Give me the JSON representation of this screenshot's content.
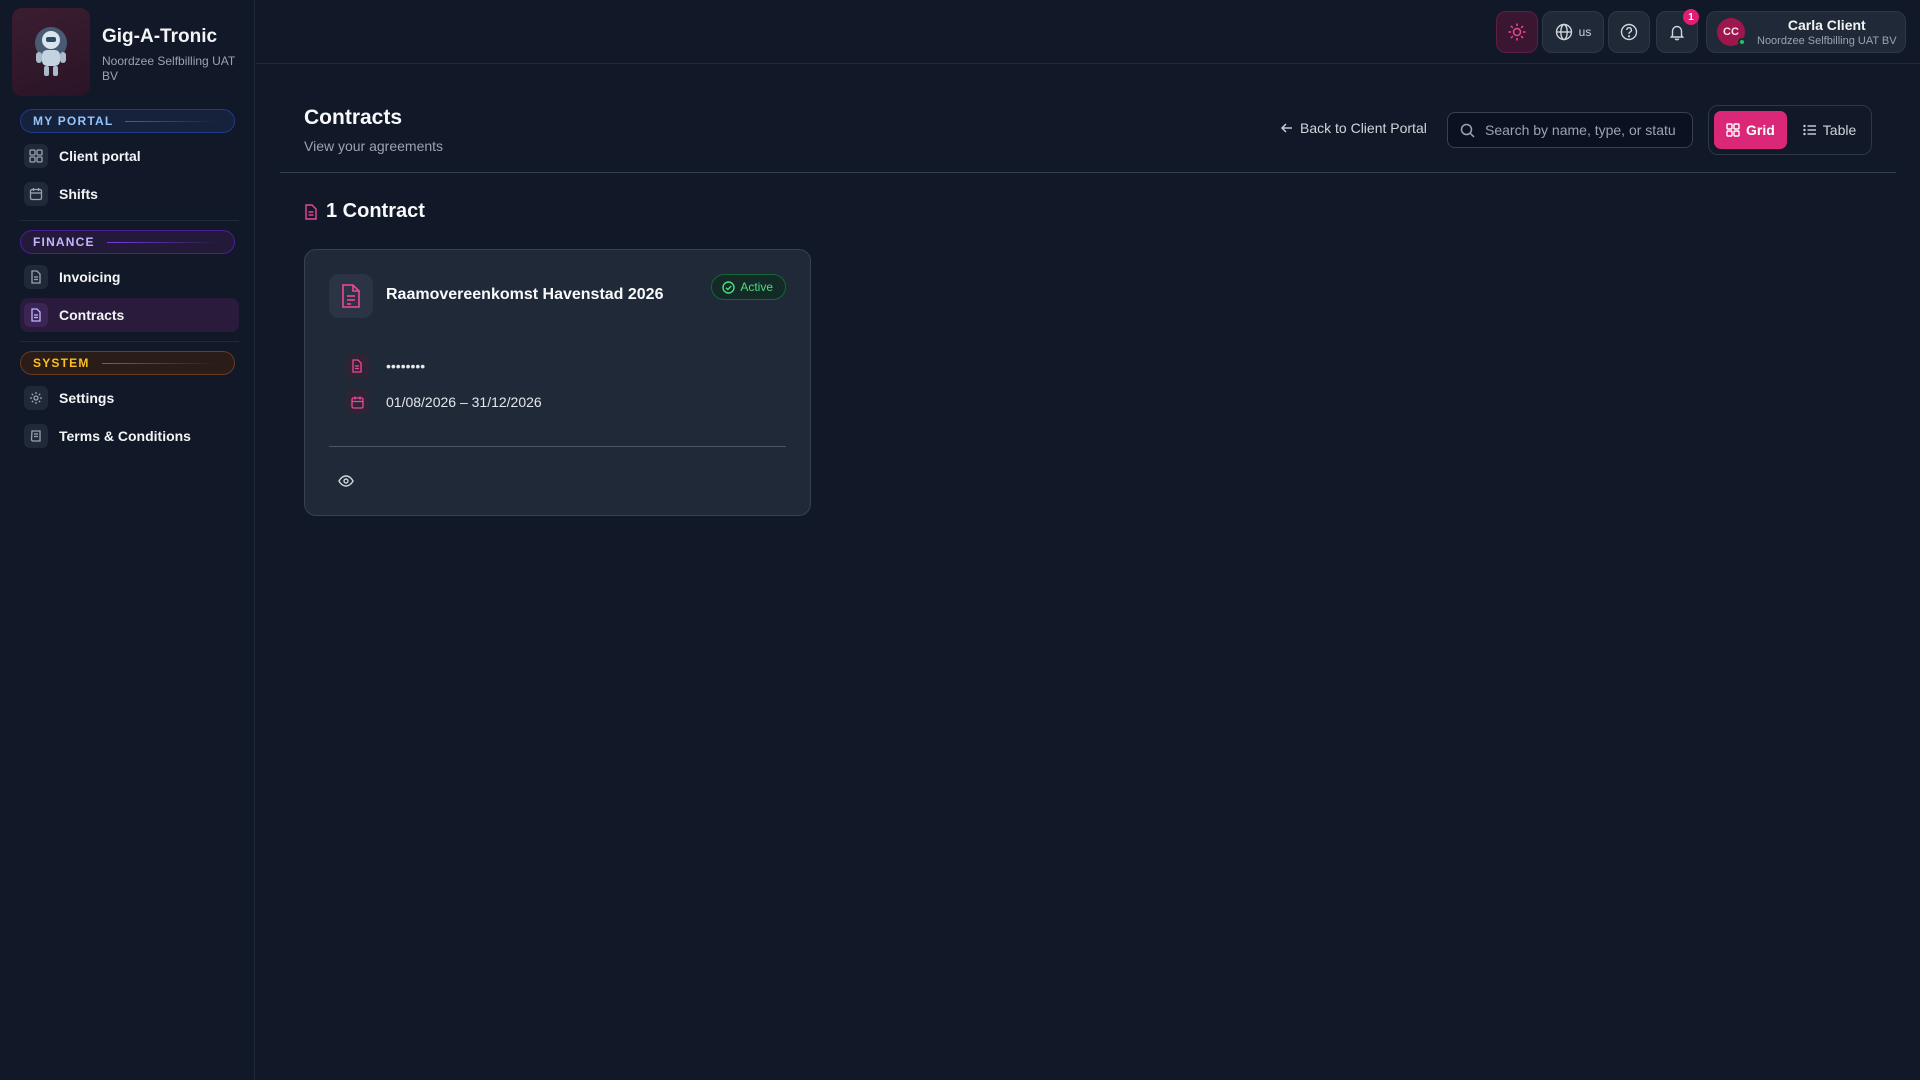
{
  "brand": {
    "name": "Gig-A-Tronic",
    "org": "Noordzee Selfbilling UAT BV"
  },
  "sidebar": {
    "sections": [
      {
        "label": "MY PORTAL",
        "items": [
          {
            "label": "Client portal",
            "icon": "grid-icon"
          },
          {
            "label": "Shifts",
            "icon": "calendar-icon"
          }
        ]
      },
      {
        "label": "FINANCE",
        "items": [
          {
            "label": "Invoicing",
            "icon": "document-icon"
          },
          {
            "label": "Contracts",
            "icon": "document-icon",
            "active": true
          }
        ]
      },
      {
        "label": "SYSTEM",
        "items": [
          {
            "label": "Settings",
            "icon": "gear-icon"
          },
          {
            "label": "Terms & Conditions",
            "icon": "scroll-icon"
          }
        ]
      }
    ]
  },
  "topbar": {
    "language": "us",
    "notifications_count": "1",
    "user": {
      "initials": "CC",
      "name": "Carla Client",
      "org": "Noordzee Selfbilling UAT BV"
    }
  },
  "header": {
    "title": "Contracts",
    "subtitle": "View your agreements",
    "back_label": "Back to Client Portal",
    "search_placeholder": "Search by name, type, or status",
    "view_grid": "Grid",
    "view_table": "Table"
  },
  "contracts": {
    "count_label": "1 Contract",
    "items": [
      {
        "title": "Raamovereenkomst Havenstad 2026",
        "status": "Active",
        "reference": "••••••••",
        "period": "01/08/2026 – 31/12/2026"
      }
    ]
  },
  "colors": {
    "accent": "#db2777",
    "background": "#111827",
    "card": "#1f2937",
    "active_status": "#4ade80"
  }
}
